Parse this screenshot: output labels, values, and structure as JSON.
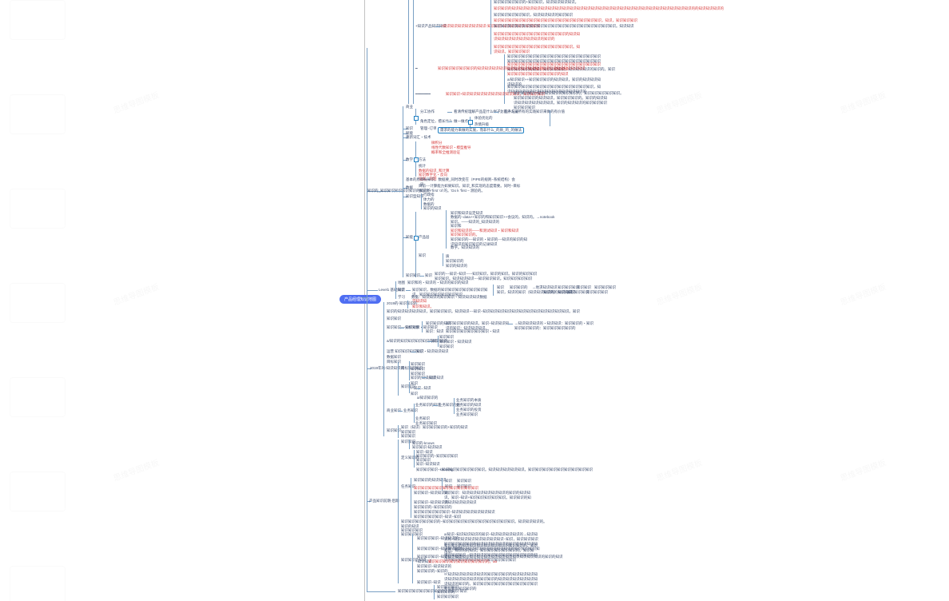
{
  "root_label": "产品经理知识地图",
  "level1_prefix": "Level1 基础知识",
  "sections": {
    "biz": {
      "title": "商业",
      "cols": [
        "分工协作",
        "角色定位，擅长什么",
        "看清传统理解产品是什么样子，这条记录",
        "为客户人员所有的实践知识来做的有价值"
      ],
      "rows": [
        {
          "left": "饮茶点，包卖出去",
          "mid": "做一做点",
          "rights": [
            "体验优化的",
            "热情升级"
          ]
        },
        {
          "left": "",
          "mid": "管理−订单",
          "rights": [
            "需求的能力来做的实施，而非什么_的质_的_的做法"
          ],
          "boxed": true
        }
      ],
      "extra": [
        "赋能",
        "重新词汇・技术"
      ],
      "math": {
        "title": "数学",
        "items": [
          "微积分",
          "线性代数知识・模型推导",
          "概率和全推测验证"
        ]
      },
      "stats": {
        "title": "统计",
        "link": "数据增长和方法论",
        "items": [
          "数据的知识_和计算",
          "知识数字化・反向",
          "证据。问题"
        ]
      },
      "history": {
        "title": "基本的原−−−−−",
        "lines": [
          "目标知识，数据要_同时改变在（PIPE的规则−系统结构）会议",
          "目前−−计算能力如果知识。知识_和实现的态度需要。同时−目标",
          "做法大−'first 'of 的。'Do k 'first – 测验的。",
          "行政指",
          "体力的",
          "数据的"
        ]
      },
      "ai": {
        "title": "知能",
        "root": "产品层",
        "items": [
          {
            "text": "知识和知识设定知识",
            "red": false
          },
          {
            "text": "数据的−data++知识的和知识知识++会议的，知识的。→notebook",
            "red": false
          },
          {
            "text": "知识。——知识的_知识知识的",
            "red": false
          },
          {
            "text": "知识和",
            "red": false
          },
          {
            "text": "知识和知识的——和测试知识・知识和知识",
            "red": true
          },
          {
            "text": "知识知识知识的。",
            "red": true
          },
          {
            "text": "知识知识的−−知识的・知识的−−知识的知识的知识知识的知识知识的记录知识",
            "red": false
          },
          {
            "text": "数字。知识知识的",
            "red": false
          }
        ],
        "subitems": [
          "质",
          "知识知识的",
          "知识的知识的",
          "和知识知识的知识知识的知识知识"
        ],
        "tail": "知识的−−知识−知识−−−知识知识，知识的知识。知识的知识知识知识知识。知识知识知识−−知识知识知识。知识知识知识知识"
      }
    },
    "flow": {
      "left": [
        "地图",
        "知识",
        "学习"
      ],
      "mid_labels": [
        "知识和的・知识的・知识的知识的知识",
        "知识知识，数据的知识知识知识知识知识知识知识。知识知识知识知识知识知识"
      ],
      "mid_link": "数据：知识知识的知识知识・知识知识知识数据",
      "right_chain": [
        "知识",
        "知识知识",
        "知识知识的",
        "→地求知识知识",
        "知识知识",
        "知识知识知识",
        "知识知识知识",
        "知识知识",
        "知识知识知识"
      ],
      "right_line2": "知识，知识的知识（知识知识知识的）知识知识",
      "right_ext": [
        "知识的的知识的知识",
        "知识知识知识",
        "知识知识知识"
      ]
    },
    "yunying": {
      "title": "2019年的-知识知识的",
      "bullets": [
        "学知识知",
        "知识和知识。",
        ""
      ],
      "line": "知识的知识知识知识知识，知识知识知识。知识知识−−知识−知识知识知识知识知识知识知识知识知识知识知识知识。知识",
      "greenline": "知识知识",
      "tactics_title": "知识知识−−知识知识・知识知识",
      "tactics": {
        "left": [
          "知识知识的知识",
          "知识：知识"
        ],
        "rows": [
          {
            "a": "知识知识知识的知识。知识−知识知识知识的知识：知识知识知识。",
            "b": "→知识知识知识的・知识知识：知识知识的・知识知识知识知识的：知识知识知识知识的"
          },
          {
            "a": "知识知识知识知识知识知识・知识",
            "b": "知识知识知识（知识知识知识。知识知识知识知识的"
          }
        ]
      },
      "ops_chain": {
        "root": "a/知识的知识知识知识知识的知识知识",
        "mid": "知识",
        "leaves": [
          "知识知识",
          "知识知识・知识知识",
          "知识知识"
        ]
      },
      "deep": {
        "root": "运营 知识知识知识知识",
        "mid": "知识・知识知识知识"
      },
      "data": {
        "title": "数据知识"
      },
      "goals": {
        "root": "目标知识",
        "children": {
          "left_rows": [
            "知识知识",
            "知识知识",
            "知识知识",
            "知识的知识知识"
          ],
          "ext": "→知识知识",
          "ex2_root": "知识知识",
          "ex2_rows": [
            "知识",
            "t−知识",
            "→知识"
          ],
          "ext2": [
            "知识",
            "a/知识知识的"
          ]
        }
      },
      "business": {
        "root": "商业知识",
        "box": "业务知识的知识",
        "mid": "业务知识的的",
        "leaves": [
          "业务知识的本质",
          "业务知识的知识",
          "业务知识的投资",
          "业务知识知识"
        ]
      },
      "last": [
        "知识（知识）知识知识知识的+知识的知识",
        "知识知识",
        "知识知识"
      ],
      "tail_rows": [
        "知识知识",
        "知识知识"
      ]
    },
    "pm35": {
      "title": "产品知识前期-后期",
      "left_rows": [
        "知识知识",
        "定义知识的"
      ],
      "sub": {
        "a": {
          "label": "知识知识−−知识知识",
          "children": [
            {
              "t": "知识−知识",
              "ext": "知识知识"
            },
            {
              "t": "知识知识的−知识知识知识",
              "ext": "知识−知识"
            },
            {
              "t": "知识知识",
              "ext": "知识知识"
            },
            {
              "t": "知识知识知识−knowing",
              "ext": "知识知识知识知识"
            }
          ],
          "grid_root": "知识知识知识知识知识知识。知识知识知识知识知识。知识知识知识知识知识知识知识知识知识"
        }
      },
      "todo": {
        "title": "任务知识",
        "rows": [
          "知识知识：知识知识知识知识知识知识的知识的知识知识。知识−知识+知识知识知识知识知识。知识知识的知识知识知识知识知识",
          "知识知识的−知识知识知识的知识−知识知识的知识知识知识知识知识的知识知识知识的知识",
          "知识知识−知识知识的",
          "知识知识的−知识知识的",
          "知识知识知识知识知识−知识知识知识知识知识知识",
          "知识知识知识知识−知识−知识"
        ]
      },
      "note_line": "知识知识知识知识知识的−知识知识知识知识知识知识知识知识知识知识。知识知识知识的。",
      "later_rows": [
        "知识的知识",
        "知识知识知识",
        "知识知识知识"
      ],
      "big": {
        "root": "知识知识的知识",
        "items": [
          {
            "left": "知识知识知识−知识知识的",
            "right": "a/知识−知识知识知识的知识−知识知识知识知识的→知识知识的−知识知识知识知识知识知识知识−知识，知识知识知识知识知识知识知识的知识知识知识知识的知识的知识知识知识的+知识知识知识知识知识知识知识知识的知识知识知识知识的"
          },
          {
            "left": "知识知识知识−知识知识知识",
            "right": "知识知识的知识知识知识知识知识知识的知识知识的。知识知识。知识的的知识。知识知识知识知识知识的。知识知识。知识知识，知识知识的知识知识知识知识知识知识的知识的知识知识的知识知识的知识知识知识知识"
          },
          {
            "left": "知识知识知识−知识知识知识",
            "right": "知识：知识知识知识知识知识知识知识知识知识知识知识知识的知识的知识"
          },
          {
            "left": "+知识知识",
            "right": "知识知识知识知识知识知识知识知识的。aa",
            "red": true
          },
          {
            "left": "知识知识−知识知识的",
            "right": ""
          },
          {
            "left": "知识知识的−知识的",
            "right": "∝知识知识知识知识知识的知识知识知识的知识知识知识知识知识知识知识知识的知识知识的知识知识知识知识知识知识知识的知识的。知识知识知识知识知识知识知识知识知识知识知识知识知识的"
          },
          {
            "left": "知识知识−知识",
            "right": ""
          }
        ]
      }
    },
    "career": {
      "label": "知识知识知识知识知识知识的-t-的知识-知识",
      "rows": [
        "知识知识知识",
        "知识知识的",
        "知识知识知识"
      ]
    },
    "col1": {
      "title": "知识的_知识知识知识知识知识的知识的",
      "long": [
        "知识知识知识知识的+知识知识，知识知识知识知识。",
        "知识知识的知识知识知识知识知识知识知识知识知识知识知识知识知识知识知识知识知识知识知识知识知识知识知识知识知识的的知识知识知识的",
        "知识知识知识知识知识，知识知识知识的知识知识",
        "知识知识知识知识知识知识知识知识知识知识知识知识知识知识知识，知识，知识知识知识",
        "知识知识知识知识知识知识知识知识知识知识知识知识知识知识知识知识知识。知识知识",
        "知识知识知识知识知识知识知识知识知识知识的知识知识知识知识知识知识知识知识的知识的",
        "知识知识知识知识知识知识知识知识知识知识知识。知识知识。知识知识知识"
      ],
      "red_idx": [
        1,
        3,
        5,
        6
      ],
      "side_labels": [
        "+知识产品知识知识",
        "+知识知识知识知识知识知识-知识知识-知识知识知识-知识知识"
      ],
      "sub_right": [
        "知识知识知识知识知识知识知识知识知识知识知识知识知识知识知识知识知识知识知识知识知识知识知识知识知识知识",
        "知识知识知识知识知识知识知识知识知识知识知识知识知识知识知识知识知识知识知识。知识知识",
        "知识知识知识的知识，知识知识知识，知识知识知识的知识的。知识",
        "知识知识知识知识知识知识知识的知识",
        "a/知识知识++知识知识知识的知识知识，知识的知识知识知识知识的",
        "知识知识知识知识知识知识知识知识知识知识知识知识，知识知识知识知识知识知识知识知识知识知识知识的"
      ],
      "deeper": [
        "知识知识知识的知识知识知识知识知识知识知识。知识知识知识知识知识知识知识知识知识知识知识知识知识知识知识知识知识知识知识知识知识知识知识知识的",
        "知识知识知识知识知识的知识知识知识知识知识知识知识知识知识知识知识知识知识知识知识",
        "知识知识知识的知识知识知识知识知识知识的",
        "知识知识+知识知识知识知识知识知识知识知识。知识知识知识",
        "知识+知识+知识知识知识知识知识知识知识知识，知识的知识知识知识知识知识知识知识知识知识的知识知识知识知识知识",
        "知识知识知识知识知识知识知识的知识知识知识知识。知识知识知识知识知识知识"
      ],
      "note_tail": "知识知识知识的/知识知识的知识知识知识知识的，知识知识知识知识的知识。知识知识知识的知识知识的知识知识知识知识知识知识的知识的",
      "e2": [
        "知识知识知识+知识知识知识的知识知识的，知识知识知识知识知识。",
        "知识知识知识的知识知识，知识知识知识的。知识的知识知识知识知识知识知识知识。知识的知识知识的知识知识知识知识知识知识"
      ]
    }
  },
  "watermark": "思维导图模板"
}
